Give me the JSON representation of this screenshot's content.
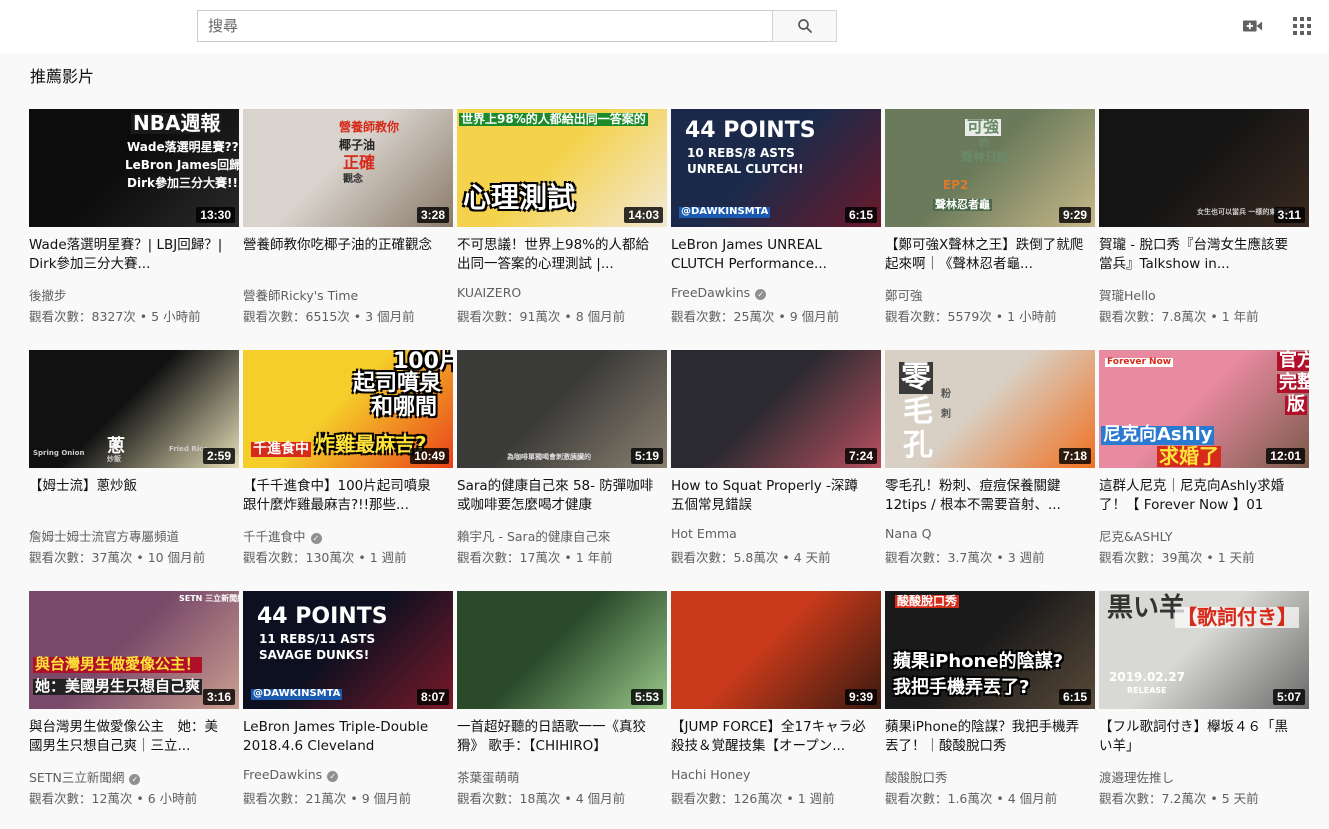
{
  "search": {
    "placeholder": "搜尋"
  },
  "section_title": "推薦影片",
  "icons": {
    "search": "search-icon",
    "upload": "video-camera-plus-icon",
    "apps": "apps-grid-icon"
  },
  "videos": [
    {
      "title": "Wade落選明星賽？| LBJ回歸？| Dirk參加三分大賽...",
      "channel": "後撤步",
      "verified": false,
      "views": "觀看次數：8327次",
      "age": "5 小時前",
      "duration": "13:30",
      "thumb_text": [
        "NBA週報",
        "Wade落選明星賽??",
        "LeBron James回歸??",
        "Dirk參加三分大賽!!"
      ],
      "thumb_colors": [
        "#0c0c0c",
        "#2a2a2a"
      ]
    },
    {
      "title": "營養師教你吃椰子油的正確觀念",
      "channel": "營養師Ricky's Time",
      "verified": false,
      "views": "觀看次數：6515次",
      "age": "3 個月前",
      "duration": "3:28",
      "thumb_text": [
        "營養師教你",
        "椰子油",
        "正確",
        "觀念"
      ],
      "thumb_colors": [
        "#d8d3cc",
        "#8a7a6a"
      ]
    },
    {
      "title": "不可思議！世界上98%的人都給出同一答案的心理測試 |...",
      "channel": "KUAIZERO",
      "verified": false,
      "views": "觀看次數：91萬次",
      "age": "8 個月前",
      "duration": "14:03",
      "thumb_text": [
        "世界上98%的人都給出同一答案的",
        "心理測試"
      ],
      "thumb_colors": [
        "#f4d24c",
        "#f2e8d5"
      ]
    },
    {
      "title": "LeBron James UNREAL CLUTCH Performance...",
      "channel": "FreeDawkins",
      "verified": true,
      "views": "觀看次數：25萬次",
      "age": "9 個月前",
      "duration": "6:15",
      "thumb_text": [
        "44 POINTS",
        "10 REBS/8 ASTS",
        "UNREAL CLUTCH!",
        "@DAWKINSMTA"
      ],
      "thumb_colors": [
        "#1b2a4a",
        "#6a1a2a"
      ]
    },
    {
      "title": "【鄭可強X聲林之王】跌倒了就爬起來啊｜《聲林忍者龜...",
      "channel": "鄭可強",
      "verified": false,
      "views": "觀看次數：5579次",
      "age": "1 小時前",
      "duration": "9:29",
      "thumb_text": [
        "可強",
        "的",
        "聲林日誌",
        "EP2",
        "聲林忍者龜"
      ],
      "thumb_colors": [
        "#6a7a5a",
        "#c8b88a"
      ]
    },
    {
      "title": "賀瓏 - 脫口秀『台灣女生應該要當兵』Talkshow in...",
      "channel": "賀瓏Hello",
      "verified": false,
      "views": "觀看次數：7.8萬次",
      "age": "1 年前",
      "duration": "3:11",
      "thumb_text": [
        "女生也可以當兵 一樣的東西呀"
      ],
      "thumb_colors": [
        "#141414",
        "#3a2a20"
      ]
    },
    {
      "title": "【姆士流】蔥炒飯",
      "channel": "詹姆士姆士流官方專屬頻道",
      "verified": false,
      "views": "觀看次數：37萬次",
      "age": "10 個月前",
      "duration": "2:59",
      "thumb_text": [
        "蔥",
        "炒飯",
        "Spring Onion",
        "Fried Rice"
      ],
      "thumb_colors": [
        "#111111",
        "#e6dfb8"
      ]
    },
    {
      "title": "【千千進食中】100片起司噴泉跟什麼炸雞最麻吉?!!那些...",
      "channel": "千千進食中",
      "verified": true,
      "views": "觀看次數：130萬次",
      "age": "1 週前",
      "duration": "10:49",
      "thumb_text": [
        "100片",
        "起司噴泉",
        "和哪間",
        "炸雞最麻吉?",
        "千進食中"
      ],
      "thumb_colors": [
        "#f6ce2a",
        "#e8401a"
      ]
    },
    {
      "title": "Sara的健康自己來 58- 防彈咖啡或咖啡要怎麼喝才健康",
      "channel": "賴宇凡 - Sara的健康自己來",
      "verified": false,
      "views": "觀看次數：17萬次",
      "age": "1 年前",
      "duration": "5:19",
      "thumb_text": [
        "為咖啡單獨喝會刺激胰臟的"
      ],
      "thumb_colors": [
        "#3a3a38",
        "#8a8070"
      ]
    },
    {
      "title": "How to Squat Properly -深蹲五個常見錯誤",
      "channel": "Hot Emma",
      "verified": false,
      "views": "觀看次數：5.8萬次",
      "age": "4 天前",
      "duration": "7:24",
      "thumb_text": [],
      "thumb_colors": [
        "#2a2a30",
        "#b85060"
      ]
    },
    {
      "title": "零毛孔！粉刺、痘痘保養關鍵12tips / 根本不需要音射、...",
      "channel": "Nana Q",
      "verified": false,
      "views": "觀看次數：3.7萬次",
      "age": "3 週前",
      "duration": "7:18",
      "thumb_text": [
        "零",
        "毛",
        "孔",
        "粉",
        "刺"
      ],
      "thumb_colors": [
        "#d8d0c4",
        "#f07020"
      ]
    },
    {
      "title": "這群人尼克｜尼克向Ashly求婚了！【 Forever Now 】01",
      "channel": "尼克&ASHLY",
      "verified": false,
      "views": "觀看次數：39萬次",
      "age": "1 天前",
      "duration": "12:01",
      "thumb_text": [
        "官方",
        "完整",
        "版",
        "尼克向Ashly",
        "求婚了",
        "Forever Now"
      ],
      "thumb_colors": [
        "#e88aa0",
        "#7a5a4a"
      ]
    },
    {
      "title": "與台灣男生做愛像公主　她：美國男生只想自己爽｜三立...",
      "channel": "SETN三立新聞網",
      "verified": true,
      "views": "觀看次數：12萬次",
      "age": "6 小時前",
      "duration": "3:16",
      "thumb_text": [
        "與台灣男生做愛像公主！",
        "她：美國男生只想自己爽",
        "SETN 三立新聞網"
      ],
      "thumb_colors": [
        "#7a4a6a",
        "#caa090"
      ]
    },
    {
      "title": "LeBron James Triple-Double 2018.4.6 Cleveland Cavalier...",
      "channel": "FreeDawkins",
      "verified": true,
      "views": "觀看次數：21萬次",
      "age": "9 個月前",
      "duration": "8:07",
      "thumb_text": [
        "44 POINTS",
        "11 REBS/11 ASTS",
        "SAVAGE DUNKS!",
        "@DAWKINSMTA"
      ],
      "thumb_colors": [
        "#0c1020",
        "#7a1a2a"
      ]
    },
    {
      "title": "一首超好聽的日語歌一一《真狡猾》 歌手：【CHIHIRO】",
      "channel": "茶葉蛋萌萌",
      "verified": false,
      "views": "觀看次數：18萬次",
      "age": "4 個月前",
      "duration": "5:53",
      "thumb_text": [],
      "thumb_colors": [
        "#2a4a2a",
        "#9ac88a"
      ]
    },
    {
      "title": "【JUMP FORCE】全17キャラ必殺技＆覚醒技集【オープン...",
      "channel": "Hachi Honey",
      "verified": false,
      "views": "觀看次數：126萬次",
      "age": "1 週前",
      "duration": "9:39",
      "thumb_text": [],
      "thumb_colors": [
        "#c83a1a",
        "#3a1a10"
      ]
    },
    {
      "title": "蘋果iPhone的陰謀？我把手機弄丟了！｜酸酸脫口秀",
      "channel": "酸酸脫口秀",
      "verified": false,
      "views": "觀看次數：1.6萬次",
      "age": "4 個月前",
      "duration": "6:15",
      "thumb_text": [
        "酸酸脫口秀",
        "蘋果iPhone的陰謀?",
        "我把手機弄丟了?"
      ],
      "thumb_colors": [
        "#1a1a1a",
        "#5a4a3a"
      ]
    },
    {
      "title": "【フル歌詞付き】欅坂４６「黒い羊」",
      "channel": "渡邉理佐推し",
      "verified": false,
      "views": "觀看次數：7.2萬次",
      "age": "5 天前",
      "duration": "5:07",
      "thumb_text": [
        "黒い羊",
        "【歌詞付き】",
        "2019.02.27",
        "RELEASE"
      ],
      "thumb_colors": [
        "#d8d8d4",
        "#6a6a6a"
      ]
    }
  ]
}
